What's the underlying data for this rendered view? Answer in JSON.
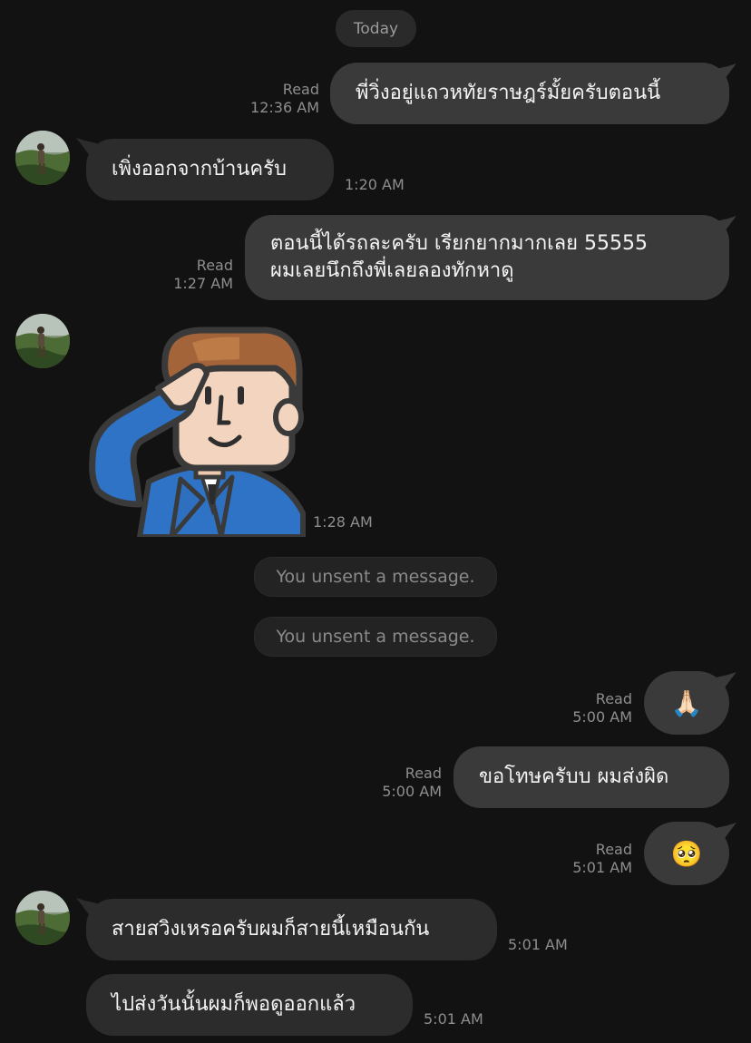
{
  "date_label": "Today",
  "messages": [
    {
      "text": "พี่วิ่งอยู่แถวหทัยราษฎร์มั้ยครับตอนนี้",
      "status": "Read",
      "time": "12:36 AM"
    },
    {
      "text": "เพิ่งออกจากบ้านครับ",
      "time": "1:20 AM"
    },
    {
      "line1": "ตอนนี้ได้รถละครับ เรียกยากมากเลย 55555",
      "line2": "ผมเลยนึกถึงพี่เลยลองทักหาดู",
      "status": "Read",
      "time": "1:27 AM"
    },
    {
      "sticker": "saluting-businessman-sticker",
      "time": "1:28 AM"
    },
    {
      "text": "You unsent a message."
    },
    {
      "text": "You unsent a message."
    },
    {
      "emoji": "🙏🏻",
      "status": "Read",
      "time": "5:00 AM"
    },
    {
      "text": "ขอโทษครับบ ผมส่งผิด",
      "status": "Read",
      "time": "5:00 AM"
    },
    {
      "emoji": "🥺",
      "status": "Read",
      "time": "5:01 AM"
    },
    {
      "text": "สายสวิงเหรอครับผมก็สายนี้เหมือนกัน",
      "time": "5:01 AM"
    },
    {
      "text": "ไปส่งวันนั้นผมก็พอดูออกแล้ว",
      "time": "5:01 AM"
    }
  ],
  "colors": {
    "background": "#121212",
    "outgoing_bubble": "#3a3a3a",
    "incoming_bubble": "#2c2c2c",
    "meta_text": "#8e8e8e"
  }
}
